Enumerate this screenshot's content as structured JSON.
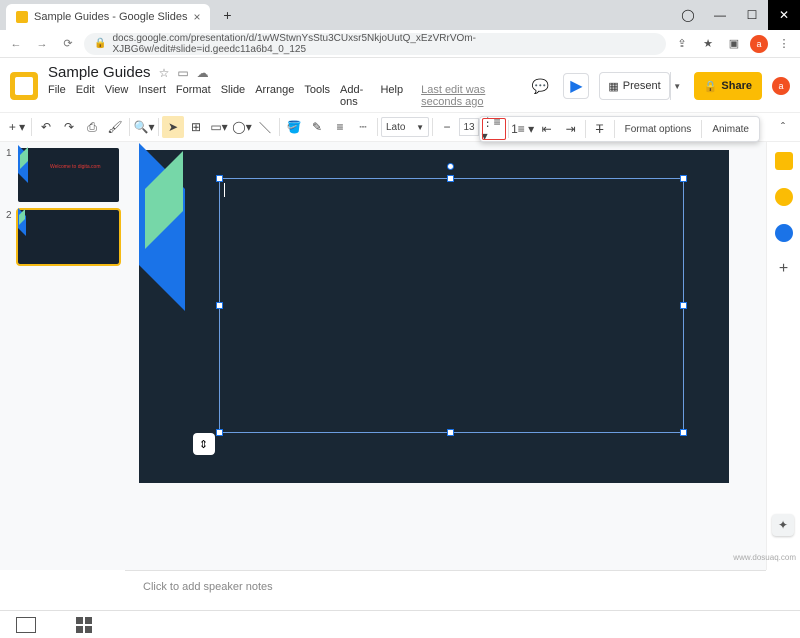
{
  "browser": {
    "tab_title": "Sample Guides - Google Slides",
    "url": "docs.google.com/presentation/d/1wWStwnYsStu3CUxsr5NkjoUutQ_xEzVRrVOm-XJBG6w/edit#slide=id.geedc11a6b4_0_125"
  },
  "doc": {
    "title": "Sample Guides",
    "last_edit": "Last edit was seconds ago"
  },
  "menu": {
    "file": "File",
    "edit": "Edit",
    "view": "View",
    "insert": "Insert",
    "format": "Format",
    "slide": "Slide",
    "arrange": "Arrange",
    "tools": "Tools",
    "addons": "Add-ons",
    "help": "Help"
  },
  "actions": {
    "present": "Present",
    "share": "Share"
  },
  "toolbar": {
    "font": "Lato",
    "font_size": "13"
  },
  "dropdown": {
    "format_options": "Format options",
    "animate": "Animate"
  },
  "thumbs": {
    "n1": "1",
    "n2": "2",
    "slide1_text": "Welcome to\\ndigita.com"
  },
  "notes": {
    "placeholder": "Click to add speaker notes"
  },
  "watermark": "www.dosuaq.com",
  "avatar_letter": "a"
}
